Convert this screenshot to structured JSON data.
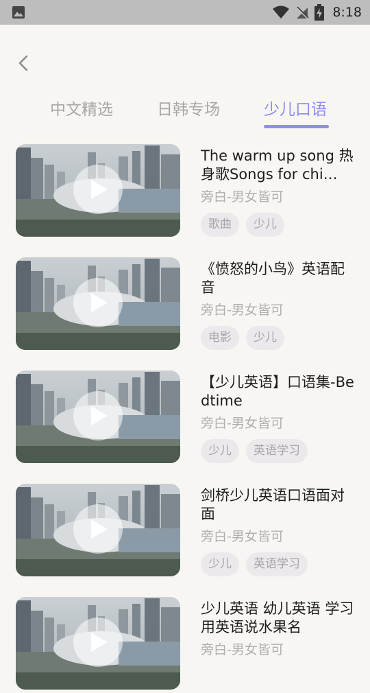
{
  "status_bar": {
    "time": "8:18"
  },
  "nav": {
    "back_icon": "chevron-left-icon"
  },
  "tabs": [
    {
      "label": "中文精选",
      "active": false
    },
    {
      "label": "日韩专场",
      "active": false
    },
    {
      "label": "少儿口语",
      "active": true
    }
  ],
  "colors": {
    "accent": "#8e8ef0",
    "background": "#f8f6f2",
    "tag_bg": "#ebe9ec"
  },
  "items": [
    {
      "title": "The warm up song 热身歌Songs for chi…",
      "subtitle": "旁白-男女皆可",
      "tags": [
        "歌曲",
        "少儿"
      ]
    },
    {
      "title": "《愤怒的小鸟》英语配音",
      "subtitle": "旁白-男女皆可",
      "tags": [
        "电影",
        "少儿"
      ]
    },
    {
      "title": "【少儿英语】口语集-Bedtime",
      "subtitle": "旁白-男女皆可",
      "tags": [
        "少儿",
        "英语学习"
      ]
    },
    {
      "title": "剑桥少儿英语口语面对面",
      "subtitle": "旁白-男女皆可",
      "tags": [
        "少儿",
        "英语学习"
      ]
    },
    {
      "title": "少儿英语 幼儿英语 学习用英语说水果名",
      "subtitle": "旁白-男女皆可",
      "tags": []
    }
  ]
}
